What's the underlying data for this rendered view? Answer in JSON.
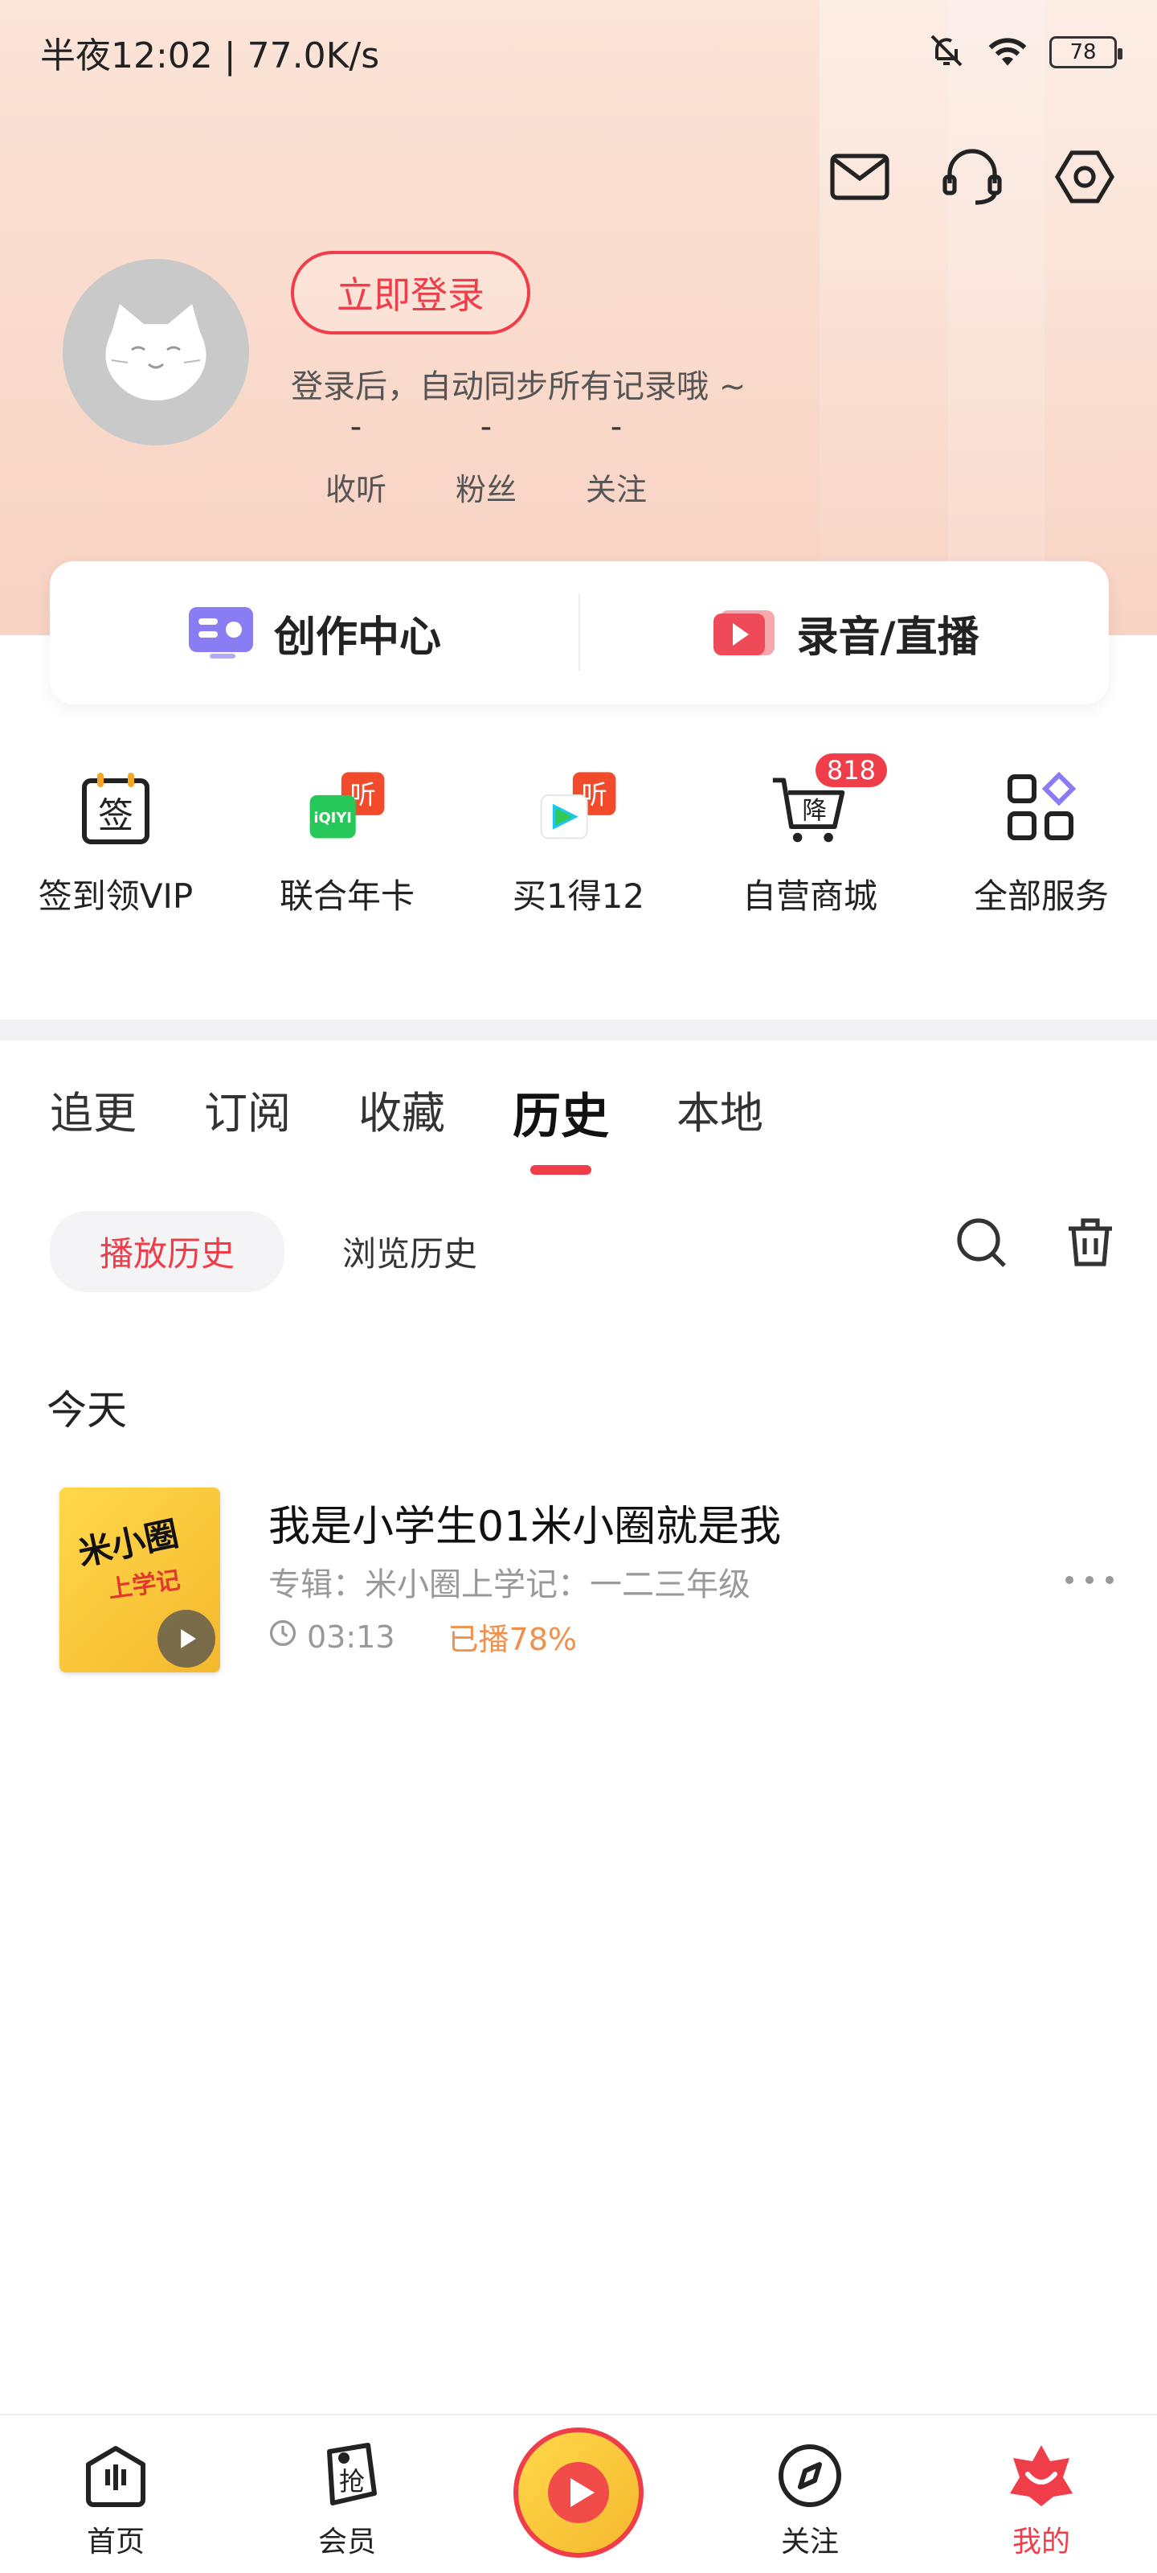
{
  "status_bar": {
    "time_speed": "半夜12:02 | 77.0K/s",
    "battery": "78"
  },
  "header_icons": [
    "mail-icon",
    "headset-icon",
    "settings-icon"
  ],
  "profile": {
    "login_button": "立即登录",
    "hint": "登录后，自动同步所有记录哦 ~",
    "stats": [
      {
        "value": "-",
        "label": "收听"
      },
      {
        "value": "-",
        "label": "粉丝"
      },
      {
        "value": "-",
        "label": "关注"
      }
    ]
  },
  "create": {
    "creator_center": "创作中心",
    "record_live": "录音/直播"
  },
  "services": [
    {
      "label": "签到领VIP",
      "icon": "checkin-icon",
      "icon_text": "签"
    },
    {
      "label": "联合年卡",
      "icon": "iqiyi-ting-icon",
      "icon_text": "iQIYI"
    },
    {
      "label": "买1得12",
      "icon": "tencent-video-ting-icon",
      "icon_text": "听"
    },
    {
      "label": "自营商城",
      "icon": "cart-icon",
      "icon_text": "降",
      "badge": "818"
    },
    {
      "label": "全部服务",
      "icon": "grid-apps-icon"
    }
  ],
  "tabs": [
    {
      "label": "追更",
      "active": false
    },
    {
      "label": "订阅",
      "active": false
    },
    {
      "label": "收藏",
      "active": false
    },
    {
      "label": "历史",
      "active": true
    },
    {
      "label": "本地",
      "active": false
    }
  ],
  "subtabs": [
    {
      "label": "播放历史",
      "active": true
    },
    {
      "label": "浏览历史",
      "active": false
    }
  ],
  "history": {
    "day_label": "今天",
    "items": [
      {
        "title": "我是小学生01米小圈就是我",
        "album": "专辑：米小圈上学记：一二三年级",
        "duration": "03:13",
        "progress_text": "已播78%",
        "cover_title": "米小圈",
        "cover_sub": "上学记"
      }
    ]
  },
  "bottom_nav": [
    {
      "label": "首页",
      "icon": "home-icon",
      "active": false
    },
    {
      "label": "会员",
      "icon": "vip-icon",
      "active": false
    },
    {
      "label": "",
      "icon": "now-playing-disc",
      "active": false
    },
    {
      "label": "关注",
      "icon": "compass-icon",
      "active": false
    },
    {
      "label": "我的",
      "icon": "mine-icon",
      "active": true
    }
  ],
  "colors": {
    "accent": "#ef3e4a",
    "progress": "#f0904a"
  }
}
